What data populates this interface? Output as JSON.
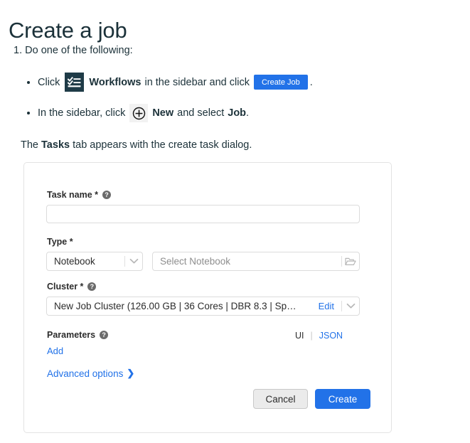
{
  "page": {
    "title": "Create a job",
    "step_number": "1.",
    "step_text": "Do one of the following:",
    "bullets": {
      "one": {
        "lead": "Click",
        "icon_label": "Workflows",
        "middle": "in the sidebar and click",
        "chip_label": "Create Job",
        "trailing": "."
      },
      "two": {
        "lead": "In the sidebar, click",
        "bold_one": "New",
        "middle": "and select",
        "bold_two": "Job",
        "trailing": "."
      }
    },
    "paragraph": {
      "before": "The",
      "bold": "Tasks",
      "after": "tab appears with the create task dialog."
    }
  },
  "dialog": {
    "task_name": {
      "label": "Task name *",
      "help": "?",
      "value": "",
      "placeholder": ""
    },
    "type": {
      "label": "Type *",
      "select_value": "Notebook",
      "notebook_placeholder": "Select Notebook",
      "folder_icon": "folder-open-icon",
      "chevron_icon": "chevron-down-icon"
    },
    "cluster": {
      "label": "Cluster *",
      "help": "?",
      "value": "New Job Cluster (126.00 GB | 36 Cores | DBR 8.3 | Sp…",
      "edit_label": "Edit",
      "chevron_icon": "chevron-down-icon"
    },
    "parameters": {
      "label": "Parameters",
      "help": "?",
      "add_label": "Add",
      "toggle_ui": "UI",
      "toggle_sep": "|",
      "toggle_json": "JSON"
    },
    "advanced": {
      "label": "Advanced options",
      "chevron": "❯"
    },
    "footer": {
      "cancel_label": "Cancel",
      "create_label": "Create"
    }
  },
  "colors": {
    "accent_blue": "#2272e8",
    "text_dark": "#1b3139",
    "sidebar_icon_bg": "#1f3b47",
    "cancel_bg": "#ebebeb",
    "border": "#dcdcdc"
  }
}
